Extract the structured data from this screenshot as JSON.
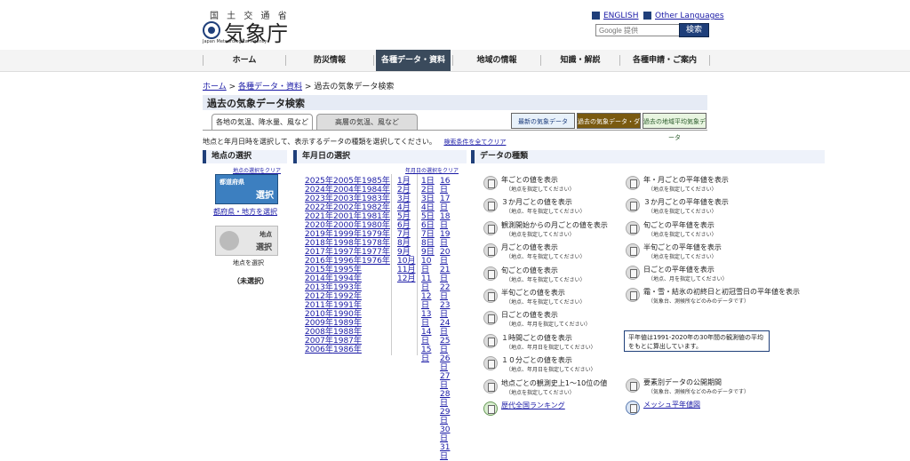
{
  "header": {
    "logo_small": "国 土 交 通 省",
    "logo_kanji": "気象庁",
    "logo_en": "Japan Meteorological Agency",
    "lang_english": "ENGLISH",
    "lang_other": "Other Languages",
    "search_placeholder": "Google 提供",
    "search_button": "検索"
  },
  "nav": {
    "items": [
      "ホーム",
      "防災情報",
      "各種データ・資料",
      "地域の情報",
      "知識・解説",
      "各種申請・ご案内"
    ]
  },
  "breadcrumb": {
    "home": "ホーム",
    "data": "各種データ・資料",
    "current": "過去の気象データ検索",
    "sep": ">"
  },
  "page_title": "過去の気象データ検索",
  "tabs": [
    "各地の気温、降水量、風など",
    "高層の気温、風など"
  ],
  "banners": [
    "最新の気象データ",
    "過去の気象データ・ダウンロード",
    "過去の地域平均気象データ"
  ],
  "instruction": "地点と年月日時を選択して、表示するデータの種類を選択してください。",
  "clear_all": "検索条件を全てクリア",
  "location": {
    "heading": "地点の選択",
    "clear": "地点の選択をクリア",
    "pref_img_top": "都道府県",
    "pref_img_bottom": "選択",
    "pref_link": "都府県・地方を選択",
    "point_img_top": "地点",
    "point_img_bottom": "選択",
    "point_label": "地点を選択",
    "status": "（未選択）"
  },
  "date": {
    "heading": "年月日の選択",
    "clear": "年月日の選択をクリア",
    "years_col1": [
      "2025年",
      "2024年",
      "2023年",
      "2022年",
      "2021年",
      "2020年",
      "2019年",
      "2018年",
      "2017年",
      "2016年",
      "2015年",
      "2014年",
      "2013年",
      "2012年",
      "2011年",
      "2010年",
      "2009年",
      "2008年",
      "2007年",
      "2006年"
    ],
    "years_col2": [
      "2005年",
      "2004年",
      "2003年",
      "2002年",
      "2001年",
      "2000年",
      "1999年",
      "1998年",
      "1997年",
      "1996年",
      "1995年",
      "1994年",
      "1993年",
      "1992年",
      "1991年",
      "1990年",
      "1989年",
      "1988年",
      "1987年",
      "1986年"
    ],
    "years_col3": [
      "1985年",
      "1984年",
      "1983年",
      "1982年",
      "1981年",
      "1980年",
      "1979年",
      "1978年",
      "1977年",
      "1976年"
    ],
    "months": [
      "1月",
      "2月",
      "3月",
      "4月",
      "5月",
      "6月",
      "7月",
      "8月",
      "9月",
      "10月",
      "11月",
      "12月"
    ],
    "days_col1": [
      "1日",
      "2日",
      "3日",
      "4日",
      "5日",
      "6日",
      "7日",
      "8日",
      "9日",
      "10日",
      "11日",
      "12日",
      "13日",
      "14日",
      "15日"
    ],
    "days_col2": [
      "16日",
      "17日",
      "18日",
      "19日",
      "20日",
      "21日",
      "22日",
      "23日",
      "24日",
      "25日",
      "26日",
      "27日",
      "28日",
      "29日",
      "30日",
      "31日"
    ]
  },
  "kinds": {
    "heading": "データの種類",
    "left": [
      {
        "label": "年ごとの値を表示",
        "sub": "（地点を指定してください）"
      },
      {
        "label": "３か月ごとの値を表示",
        "sub": "（地点、年を指定してください）"
      },
      {
        "label": "観測開始からの月ごとの値を表示",
        "sub": "（地点を指定してください）"
      },
      {
        "label": "月ごとの値を表示",
        "sub": "（地点、年を指定してください）"
      },
      {
        "label": "旬ごとの値を表示",
        "sub": "（地点、年を指定してください）"
      },
      {
        "label": "半旬ごとの値を表示",
        "sub": "（地点、年を指定してください）"
      },
      {
        "label": "日ごとの値を表示",
        "sub": "（地点、年月を指定してください）"
      },
      {
        "label": "１時間ごとの値を表示",
        "sub": "（地点、年月日を指定してください）"
      },
      {
        "label": "１０分ごとの値を表示",
        "sub": "（地点、年月日を指定してください）"
      },
      {
        "label": "地点ごとの観測史上1～10位の値",
        "sub": "（地点を指定してください）"
      },
      {
        "label": "歴代全国ランキング",
        "sub": ""
      }
    ],
    "right": [
      {
        "label": "年・月ごとの平年値を表示",
        "sub": "（地点を指定してください）"
      },
      {
        "label": "３か月ごとの平年値を表示",
        "sub": "（地点を指定してください）"
      },
      {
        "label": "旬ごとの平年値を表示",
        "sub": "（地点を指定してください）"
      },
      {
        "label": "半旬ごとの平年値を表示",
        "sub": "（地点を指定してください）"
      },
      {
        "label": "日ごとの平年値を表示",
        "sub": "（地点、月を指定してください）"
      },
      {
        "label": "霜・雪・結氷の初終日と初冠雪日の平年値を表示",
        "sub": "（気象台、測候所などのみのデータです）"
      },
      {
        "label": "要素別データの公開期間",
        "sub": "（気象台、測候所などのみのデータです）"
      },
      {
        "label": "メッシュ平年値図",
        "sub": ""
      }
    ],
    "note": "平年値は1991-2020年の30年間の観測値の平均をもとに算出しています。"
  }
}
